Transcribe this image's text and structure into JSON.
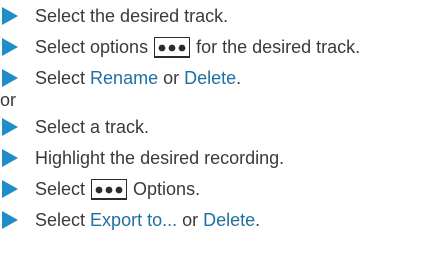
{
  "colors": {
    "bullet": "#1f8dc8",
    "link": "#1f6fa3",
    "text": "#3a3a3a"
  },
  "group1": {
    "step1": "Select the desired track.",
    "step2_pre": "Select options",
    "step2_post": "for the desired track.",
    "step3_pre": "Select",
    "step3_link1": "Rename",
    "step3_mid": "or",
    "step3_link2": "Delete",
    "step3_end": "."
  },
  "separator": "or",
  "group2": {
    "step1": "Select a track.",
    "step2": "Highlight the desired recording.",
    "step3_pre": "Select",
    "step3_post": "Options.",
    "step4_pre": "Select",
    "step4_link1": "Export to...",
    "step4_mid": "or",
    "step4_link2": "Delete",
    "step4_end": "."
  },
  "icons": {
    "bullet": "triangle-right-icon",
    "options": "options-dots-icon"
  }
}
